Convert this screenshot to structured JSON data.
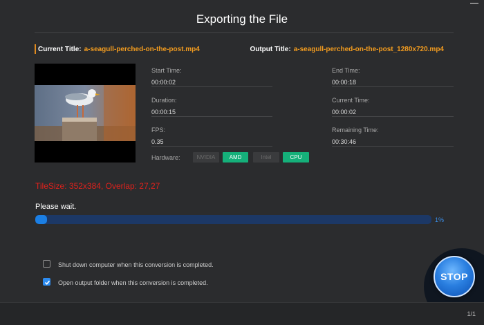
{
  "window": {
    "title": "Exporting the File"
  },
  "files": {
    "current_label": "Current Title:",
    "current_value": "a-seagull-perched-on-the-post.mp4",
    "output_label": "Output Title:",
    "output_value": "a-seagull-perched-on-the-post_1280x720.mp4"
  },
  "info": {
    "start_time_label": "Start Time:",
    "start_time": "00:00:02",
    "end_time_label": "End Time:",
    "end_time": "00:00:18",
    "duration_label": "Duration:",
    "duration": "00:00:15",
    "current_time_label": "Current Time:",
    "current_time": "00:00:02",
    "fps_label": "FPS:",
    "fps": "0.35",
    "remaining_label": "Remaining Time:",
    "remaining": "00:30:46"
  },
  "hardware": {
    "label": "Hardware:",
    "options": [
      {
        "label": "NVIDIA",
        "active": false
      },
      {
        "label": "AMD",
        "active": true
      },
      {
        "label": "Intel",
        "active": false
      },
      {
        "label": "CPU",
        "active": true
      }
    ]
  },
  "status": {
    "tile_text": "TileSize: 352x384, Overlap: 27,27",
    "wait_text": "Please wait.",
    "progress_percent": 1,
    "progress_label": "1%"
  },
  "options": {
    "shutdown_label": "Shut down computer when this conversion is completed.",
    "shutdown_checked": false,
    "open_folder_label": "Open output folder when this conversion is completed.",
    "open_folder_checked": true
  },
  "stop_button": {
    "label": "STOP"
  },
  "footer": {
    "page": "1/1"
  },
  "colors": {
    "accent_orange": "#f39c1f",
    "active_green": "#15b07a",
    "warning_red": "#e0211c",
    "progress_blue": "#1b7fe4"
  },
  "icons": [
    "minimize-icon",
    "checkbox-check-icon"
  ]
}
